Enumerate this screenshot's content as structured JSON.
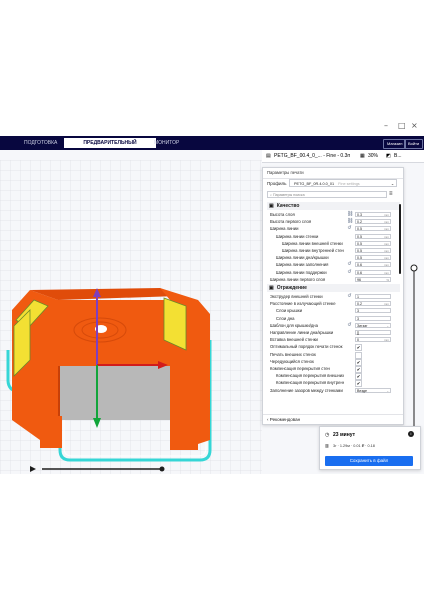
{
  "window": {
    "minimize": "–",
    "maximize": "□",
    "close": "×"
  },
  "nav": {
    "tabs": [
      "ПОДГОТОВКА",
      "ПРЕДВАРИТЕЛЬНЫЙ ПРОСМОТР",
      "МОНИТОР"
    ],
    "active_tab_index": 1,
    "marketplace_label": "Магазин",
    "signin_label": "Войти"
  },
  "job": {
    "name": "PETG_BF_00.4_0_... - Fine - 0.3mm",
    "infill_percent": "30%",
    "support_label": "В..."
  },
  "settings": {
    "title": "Параметры печати",
    "profile_label": "Профиль",
    "profile_value": "PETG_BF_0R.4.0.0_01",
    "profile_hint": "Fine settings",
    "search_placeholder": "Параметры поиска",
    "recommended_label": "Рекомендован",
    "categories": [
      {
        "name": "Качество",
        "icon": "quality-icon",
        "rows": [
          {
            "label": "Высота слоя",
            "value": "0.3",
            "unit": "mm",
            "indent": 0,
            "mark": "link-icon"
          },
          {
            "label": "Высота первого слоя",
            "value": "0.2",
            "unit": "mm",
            "indent": 0,
            "mark": "link-icon"
          },
          {
            "label": "Ширина линии",
            "value": "0.5",
            "unit": "mm",
            "indent": 0,
            "mark": "reset-icon"
          },
          {
            "label": "Ширина линии стенки",
            "value": "0.5",
            "unit": "mm",
            "indent": 1,
            "mark": ""
          },
          {
            "label": "Ширина линии внешней стенки",
            "value": "0.5",
            "unit": "mm",
            "indent": 2,
            "mark": ""
          },
          {
            "label": "Ширина линии внутренней стенки",
            "value": "0.5",
            "unit": "mm",
            "indent": 2,
            "mark": ""
          },
          {
            "label": "Ширина линии дна/крышки",
            "value": "0.5",
            "unit": "mm",
            "indent": 1,
            "mark": ""
          },
          {
            "label": "Ширина линии заполнения",
            "value": "0.6",
            "unit": "mm",
            "indent": 1,
            "mark": "reset-icon"
          },
          {
            "label": "Ширина линии поддержки",
            "value": "0.6",
            "unit": "mm",
            "indent": 1,
            "mark": "reset-icon"
          },
          {
            "label": "Ширина линии первого слоя",
            "value": "96",
            "unit": "%",
            "indent": 0,
            "mark": ""
          }
        ]
      },
      {
        "name": "Ограждение",
        "icon": "shell-icon",
        "rows": [
          {
            "label": "Экструдер внешней стенки",
            "value": "1",
            "unit": "",
            "indent": 0,
            "mark": "reset-icon"
          },
          {
            "label": "Расстояние в излучающей стенке",
            "value": "0.2",
            "unit": "mm",
            "indent": 0,
            "mark": ""
          },
          {
            "label": "Слои крышки",
            "value": "3",
            "unit": "",
            "indent": 1,
            "mark": ""
          },
          {
            "label": "Слои дна",
            "value": "3",
            "unit": "",
            "indent": 1,
            "mark": ""
          },
          {
            "label": "Шаблон для крышки/дна",
            "value": "Зигзаг",
            "unit": "",
            "indent": 0,
            "mark": "reset-icon",
            "select": true
          },
          {
            "label": "Направление линии дна/крышки",
            "value": "[]",
            "unit": "",
            "indent": 0,
            "mark": ""
          },
          {
            "label": "Вставка внешней стенки",
            "value": "0",
            "unit": "mm",
            "indent": 0,
            "mark": ""
          },
          {
            "label": "Оптимальный порядок печати стенок",
            "check": true,
            "indent": 0,
            "mark": ""
          },
          {
            "label": "Печать внешних стенок",
            "check": false,
            "indent": 0,
            "mark": ""
          },
          {
            "label": "Чередующийся стенок",
            "check": true,
            "indent": 0,
            "mark": ""
          },
          {
            "label": "Компенсация перекрытия стен",
            "check": true,
            "indent": 0,
            "mark": ""
          },
          {
            "label": "Компенсация перекрытия внешних стен",
            "check": true,
            "indent": 1,
            "mark": ""
          },
          {
            "label": "Компенсация перекрытия внутренних стен",
            "check": true,
            "indent": 1,
            "mark": ""
          },
          {
            "label": "Заполнение зазоров между стенками",
            "value": "Везде",
            "unit": "",
            "indent": 0,
            "mark": "",
            "select": true
          }
        ]
      }
    ]
  },
  "print": {
    "time": "23 минут",
    "material": "3г · 1.29м · 0.01 ₽ · 0.18",
    "save_label": "Сохранить в файл",
    "info_icon": "info-icon"
  },
  "colors": {
    "nav_bg": "#08073f",
    "accent": "#196ef0",
    "model_orange": "#f05a10",
    "model_yellow": "#f3e033",
    "skirt_cyan": "#36d6d6"
  }
}
